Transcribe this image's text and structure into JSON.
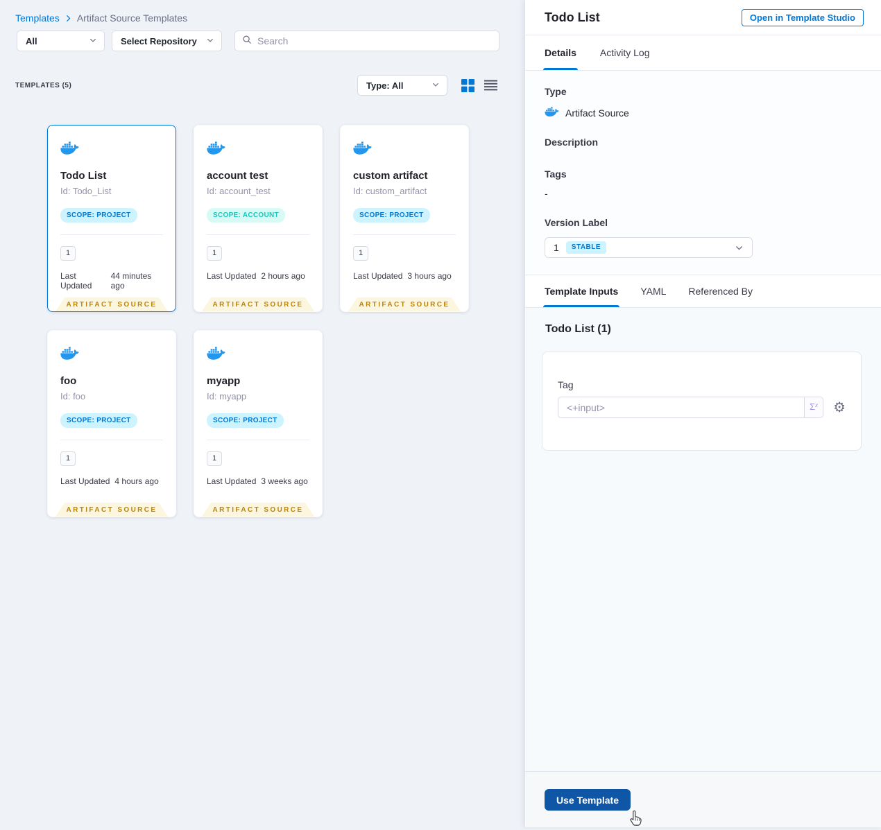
{
  "breadcrumb": {
    "root": "Templates",
    "current": "Artifact Source Templates"
  },
  "filters": {
    "scope_dropdown": "All",
    "repository_dropdown": "Select Repository",
    "search_placeholder": "Search"
  },
  "list_header": {
    "count": "TEMPLATES (5)",
    "type_dropdown": "Type: All"
  },
  "cards": [
    {
      "title": "Todo List",
      "id": "Id: Todo_List",
      "scope": "SCOPE: PROJECT",
      "version": "1",
      "updated_label": "Last Updated",
      "updated_value": "44 minutes ago",
      "type_ribbon": "ARTIFACT SOURCE"
    },
    {
      "title": "account test",
      "id": "Id: account_test",
      "scope": "SCOPE: ACCOUNT",
      "version": "1",
      "updated_label": "Last Updated",
      "updated_value": "2 hours ago",
      "type_ribbon": "ARTIFACT SOURCE"
    },
    {
      "title": "custom artifact",
      "id": "Id: custom_artifact",
      "scope": "SCOPE: PROJECT",
      "version": "1",
      "updated_label": "Last Updated",
      "updated_value": "3 hours ago",
      "type_ribbon": "ARTIFACT SOURCE"
    },
    {
      "title": "foo",
      "id": "Id: foo",
      "scope": "SCOPE: PROJECT",
      "version": "1",
      "updated_label": "Last Updated",
      "updated_value": "4 hours ago",
      "type_ribbon": "ARTIFACT SOURCE"
    },
    {
      "title": "myapp",
      "id": "Id: myapp",
      "scope": "SCOPE: PROJECT",
      "version": "1",
      "updated_label": "Last Updated",
      "updated_value": "3 weeks ago",
      "type_ribbon": "ARTIFACT SOURCE"
    }
  ],
  "panel": {
    "title": "Todo List",
    "open_studio_button": "Open in Template Studio",
    "tabs": {
      "details": "Details",
      "activity_log": "Activity Log"
    },
    "details": {
      "type_label": "Type",
      "type_value": "Artifact Source",
      "description_label": "Description",
      "tags_label": "Tags",
      "tags_value": "-",
      "version_label": "Version Label",
      "version_value": "1",
      "version_badge": "STABLE"
    },
    "inner_tabs": {
      "template_inputs": "Template Inputs",
      "yaml": "YAML",
      "referenced_by": "Referenced By"
    },
    "inputs": {
      "heading": "Todo List (1)",
      "tag_label": "Tag",
      "tag_value": "<+input>"
    },
    "footer": {
      "use_template_button": "Use Template"
    }
  },
  "icons": {
    "gear": "⚙",
    "sigma": "Σ",
    "sigma_sup": "x"
  },
  "colors": {
    "primary": "#0278d5",
    "docker_blue": "#2396ed",
    "scope_project_bg": "#cdf4fe",
    "scope_project_text": "#0278d5",
    "scope_account_bg": "#d7fbf4",
    "scope_account_text": "#1bc5bd",
    "ribbon_bg": "#fdf6df",
    "ribbon_text": "#bd8305",
    "stable_badge_bg": "#cdf4fe",
    "stable_badge_text": "#0278d5",
    "use_template_bg": "#0f57a6"
  }
}
